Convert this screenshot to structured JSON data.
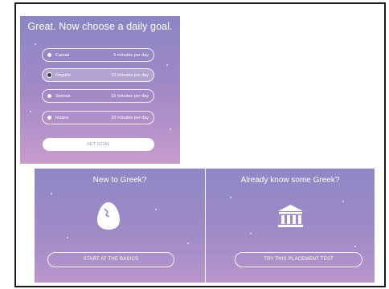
{
  "goal": {
    "title": "Great. Now choose a daily goal.",
    "options": [
      {
        "label": "Casual",
        "time": "5 minutes per day",
        "selected": false
      },
      {
        "label": "Regular",
        "time": "10 minutes per day",
        "selected": true
      },
      {
        "label": "Serious",
        "time": "15 minutes per day",
        "selected": false
      },
      {
        "label": "Insane",
        "time": "20 minutes per day",
        "selected": false
      }
    ],
    "set_goal_label": "SET GOAL"
  },
  "new_learner": {
    "title": "New to Greek?",
    "button_label": "START AT THE BASICS",
    "icon": "egg-icon"
  },
  "placement": {
    "title": "Already know some Greek?",
    "button_label": "TRY THIS PLACEMENT TEST",
    "icon": "building-icon"
  },
  "colors": {
    "panel_top": "#8a86c4",
    "panel_bottom": "#c89ccd",
    "text": "#ffffff"
  }
}
